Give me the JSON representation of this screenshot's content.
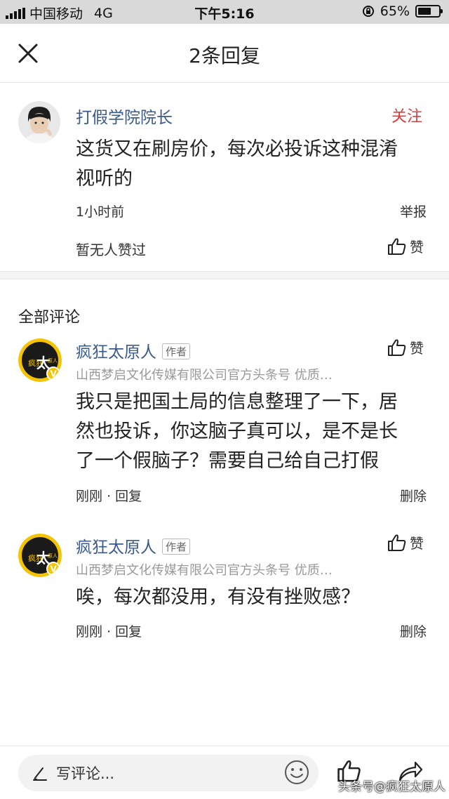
{
  "status": {
    "carrier": "中国移动",
    "network": "4G",
    "time": "下午5:16",
    "battery": "65%",
    "battery_level": 0.65
  },
  "nav": {
    "title": "2条回复",
    "close_icon": "close-icon"
  },
  "main_comment": {
    "user": "打假学院院长",
    "follow": "关注",
    "text_line1": "这货又在刷房价，每次必投诉这种混淆",
    "text_line2": "视听的",
    "time": "1小时前",
    "report": "举报",
    "no_likes": "暂无人赞过",
    "like": "赞"
  },
  "section": {
    "title": "全部评论"
  },
  "replies": [
    {
      "user": "疯狂太原人",
      "tag": "作者",
      "source": "山西梦启文化传媒有限公司官方头条号 优质…",
      "like": "赞",
      "text_line1": "我只是把国土局的信息整理了一下，居",
      "text_line2": "然也投诉，你这脑子真可以，是不是长",
      "text_line3": "了一个假脑子？需要自己给自己打假",
      "time": "刚刚",
      "reply": "回复",
      "delete": "删除"
    },
    {
      "user": "疯狂太原人",
      "tag": "作者",
      "source": "山西梦启文化传媒有限公司官方头条号 优质…",
      "like": "赞",
      "text_line1": "唉，每次都没用，有没有挫败感？",
      "time": "刚刚",
      "reply": "回复",
      "delete": "删除"
    }
  ],
  "bottom": {
    "placeholder": "写评论..."
  },
  "avatar_badge": {
    "line1": "疯狂",
    "big": "太",
    "small": "原人",
    "v": "V"
  },
  "watermark": "头条号@疯狂太原人",
  "colors": {
    "name": "#3a5a8c",
    "follow": "#e23b3b",
    "badge": "#f5c400"
  }
}
